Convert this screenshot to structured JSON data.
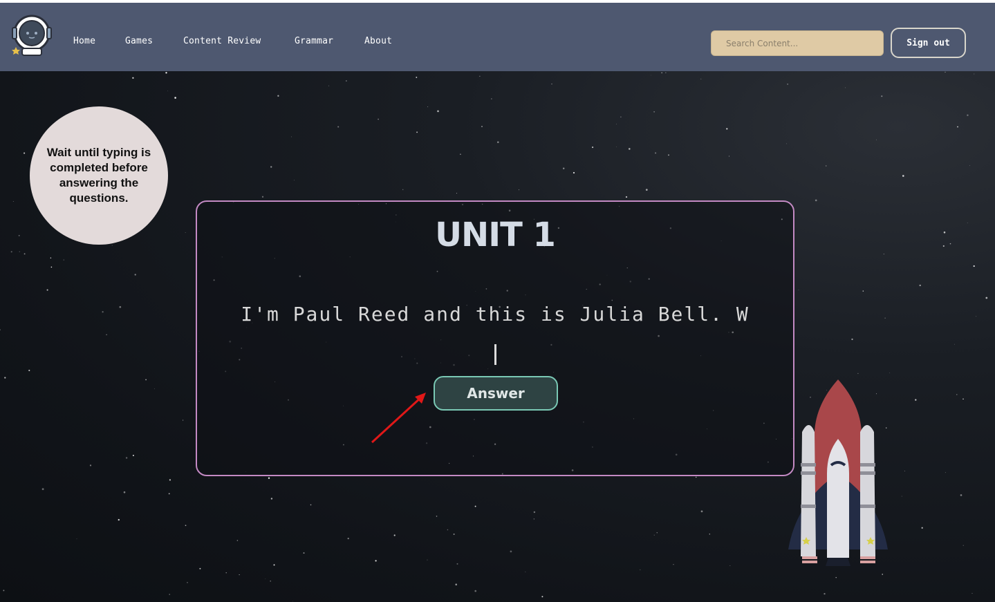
{
  "nav": {
    "items": [
      {
        "label": "Home"
      },
      {
        "label": "Games"
      },
      {
        "label": "Content Review"
      },
      {
        "label": "Grammar"
      },
      {
        "label": "About"
      }
    ],
    "search_placeholder": "Search Content...",
    "signout_label": "Sign out"
  },
  "hint": {
    "text": "Wait until typing is completed before answering the questions."
  },
  "card": {
    "title": "UNIT 1",
    "typed_text": "I'm Paul Reed and this is Julia Bell. W",
    "answer_label": "Answer"
  },
  "colors": {
    "navbar": "#4e5870",
    "search_bg": "#dfcaa5",
    "card_border": "#c48ac4",
    "answer_border": "#7ac9b5",
    "bubble_bg": "#e3dada"
  }
}
